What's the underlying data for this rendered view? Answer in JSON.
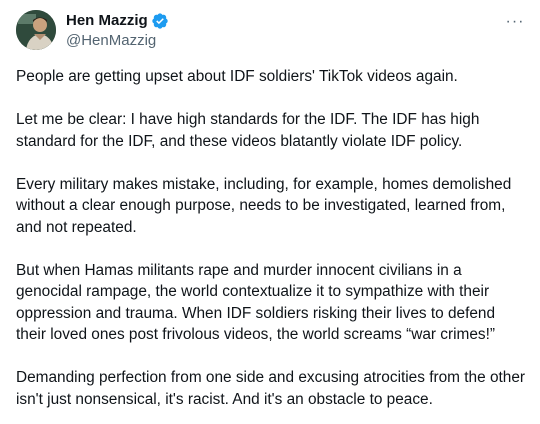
{
  "author": {
    "display_name": "Hen Mazzig",
    "handle": "@HenMazzig",
    "verified_icon": "verified-badge-icon",
    "verified_color": "#1d9bf0"
  },
  "menu": {
    "more_icon": "more-horizontal-icon",
    "more_label": "···"
  },
  "tweet": {
    "paragraphs": [
      "People are getting upset about IDF soldiers' TikTok videos again.",
      "Let me be clear: I have high standards for the IDF. The IDF has high standard for the IDF, and these videos blatantly violate IDF policy.",
      "Every military makes mistake, including, for example, homes demolished without a clear enough purpose, needs to be investigated, learned from, and not repeated.",
      "But when Hamas militants rape and murder innocent civilians in a genocidal rampage, the world contextualize it to sympathize with their oppression and trauma. When IDF soldiers risking their lives to defend their loved ones post frivolous videos, the world screams “war crimes!”",
      "Demanding perfection from one side and excusing atrocities from the other isn't just nonsensical, it's racist. And it's an obstacle to peace."
    ]
  }
}
